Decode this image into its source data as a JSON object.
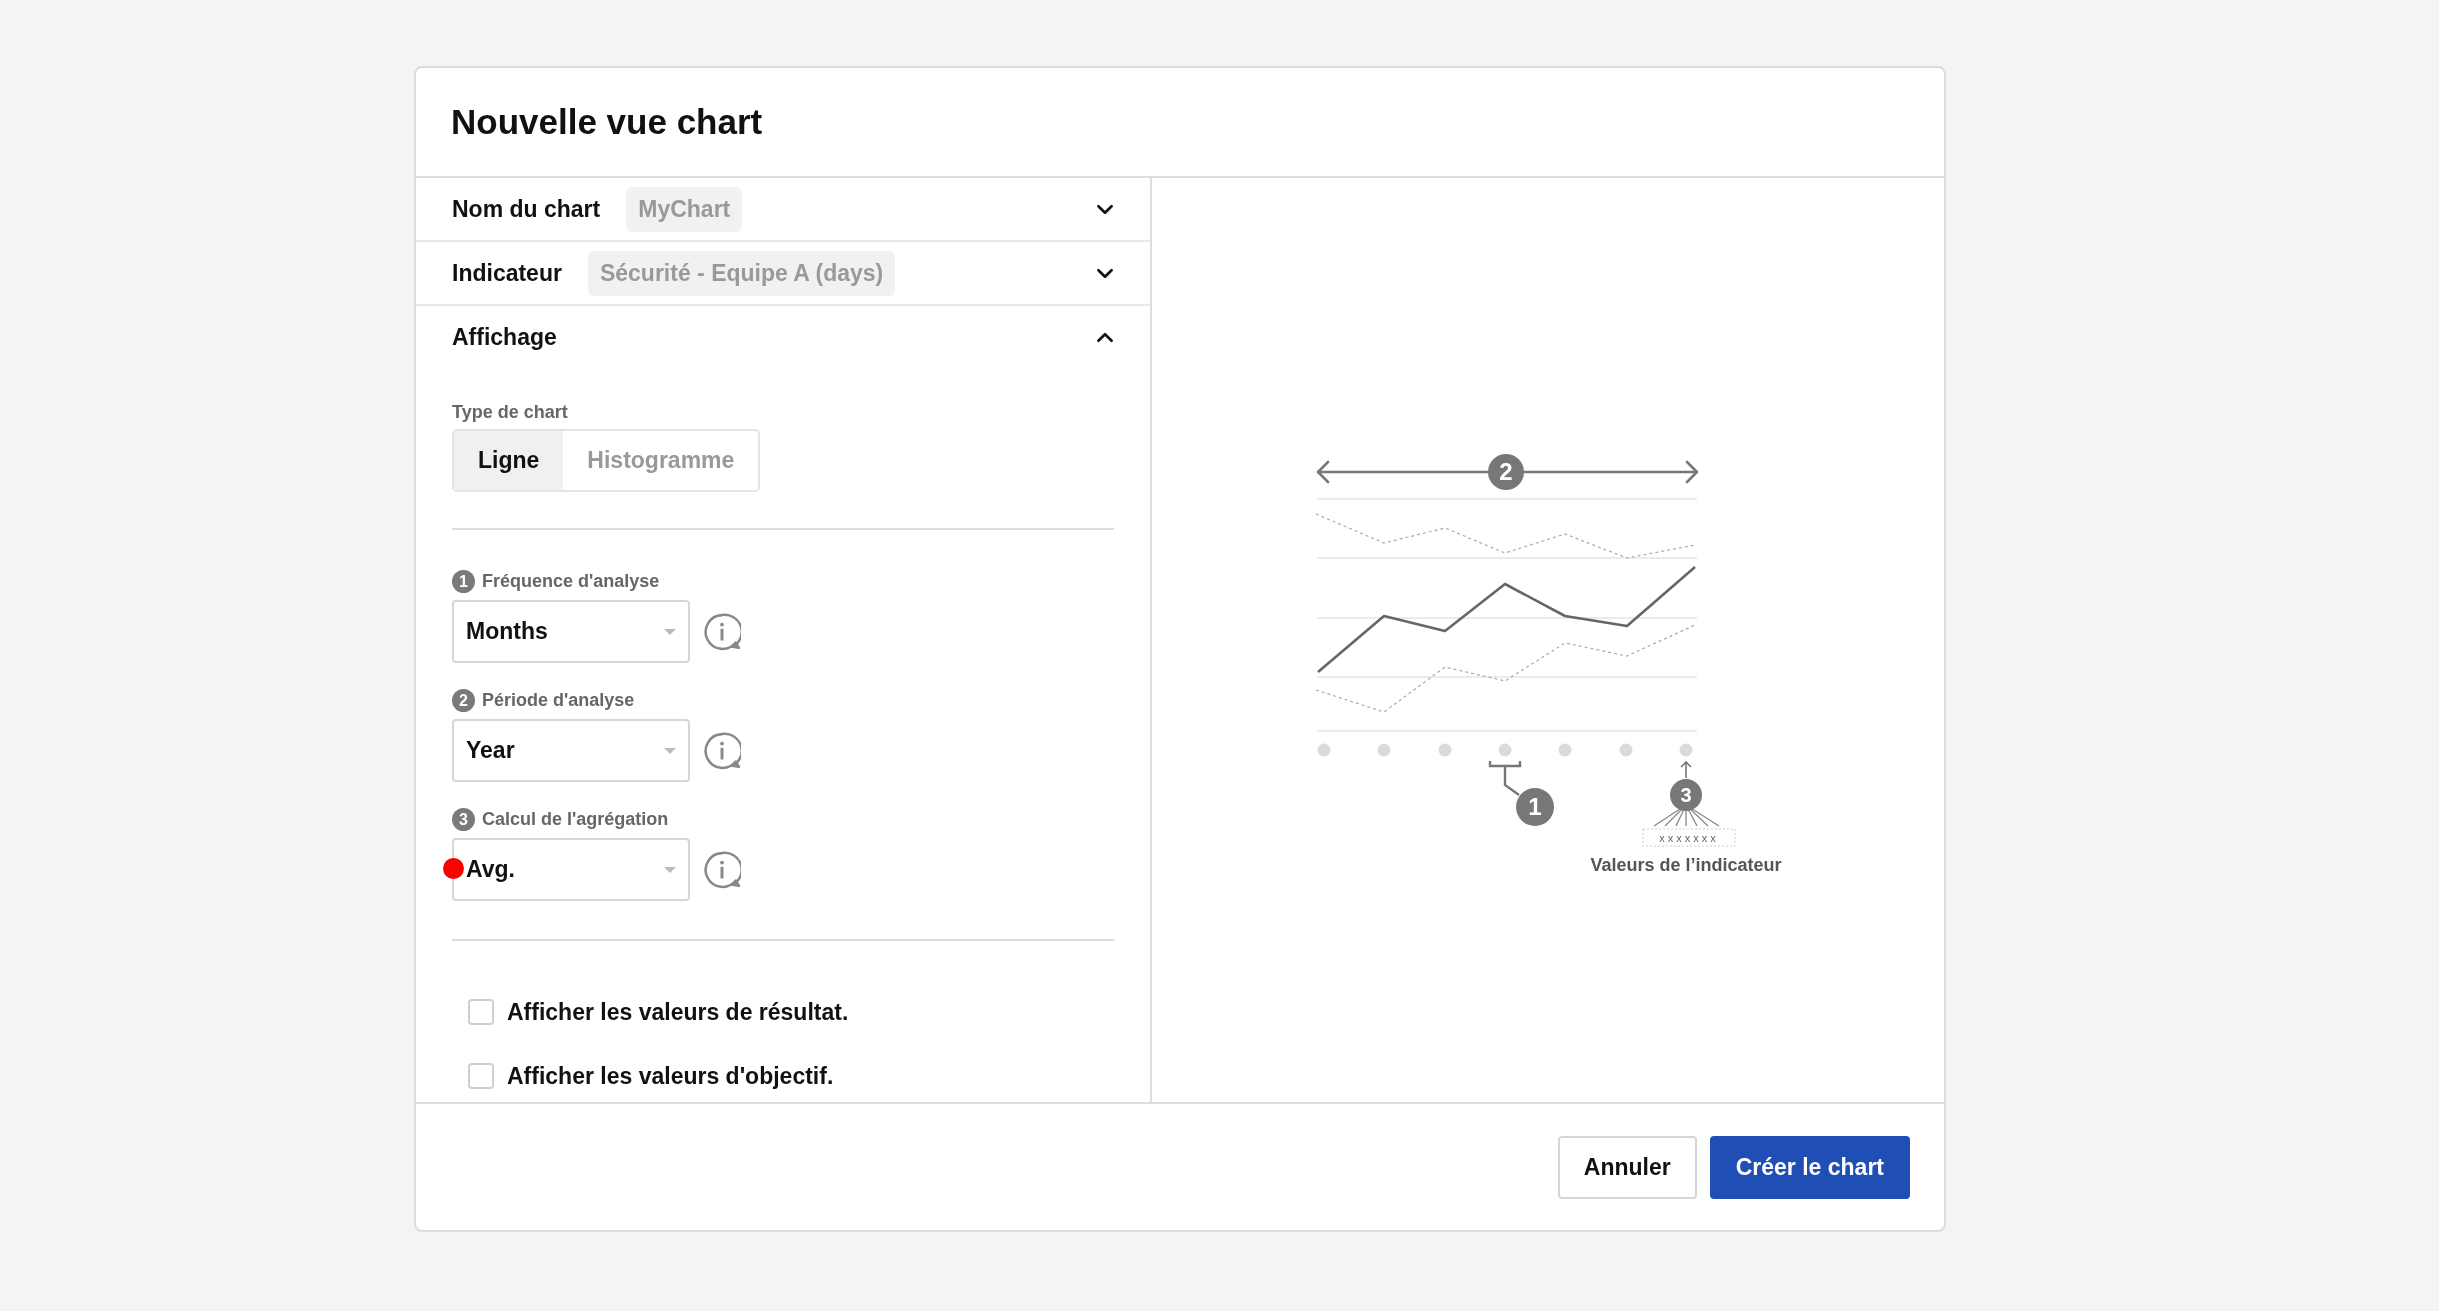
{
  "dialog": {
    "title": "Nouvelle vue chart"
  },
  "sections": [
    {
      "kind": "chip",
      "label": "Nom du chart",
      "value": "MyChart",
      "expanded": false
    },
    {
      "kind": "chip",
      "label": "Indicateur",
      "value": "Sécurité - Equipe A (days)",
      "expanded": false
    },
    {
      "kind": "panel",
      "label": "Affichage",
      "expanded": true
    }
  ],
  "chart_type": {
    "label": "Type de chart",
    "options": [
      {
        "label": "Ligne",
        "selected": true
      },
      {
        "label": "Histogramme",
        "selected": false
      }
    ]
  },
  "settings": [
    {
      "number": "1",
      "label": "Fréquence d'analyse",
      "value": "Months",
      "marked": false
    },
    {
      "number": "2",
      "label": "Période d'analyse",
      "value": "Year",
      "marked": false
    },
    {
      "number": "3",
      "label": "Calcul de l'agrégation",
      "value": "Avg.",
      "marked": true
    }
  ],
  "checkboxes": [
    {
      "label": "Afficher les valeurs de résultat.",
      "checked": false
    },
    {
      "label": "Afficher les valeurs d'objectif.",
      "checked": false
    }
  ],
  "illustration": {
    "period_badge": "2",
    "frequency_badge": "1",
    "aggregation_badge": "3",
    "value_marks": "xxxxxxx",
    "caption": "Valeurs de l’indicateur"
  },
  "buttons": [
    {
      "label": "Annuler",
      "kind": "secondary"
    },
    {
      "label": "Créer le chart",
      "kind": "primary"
    }
  ]
}
